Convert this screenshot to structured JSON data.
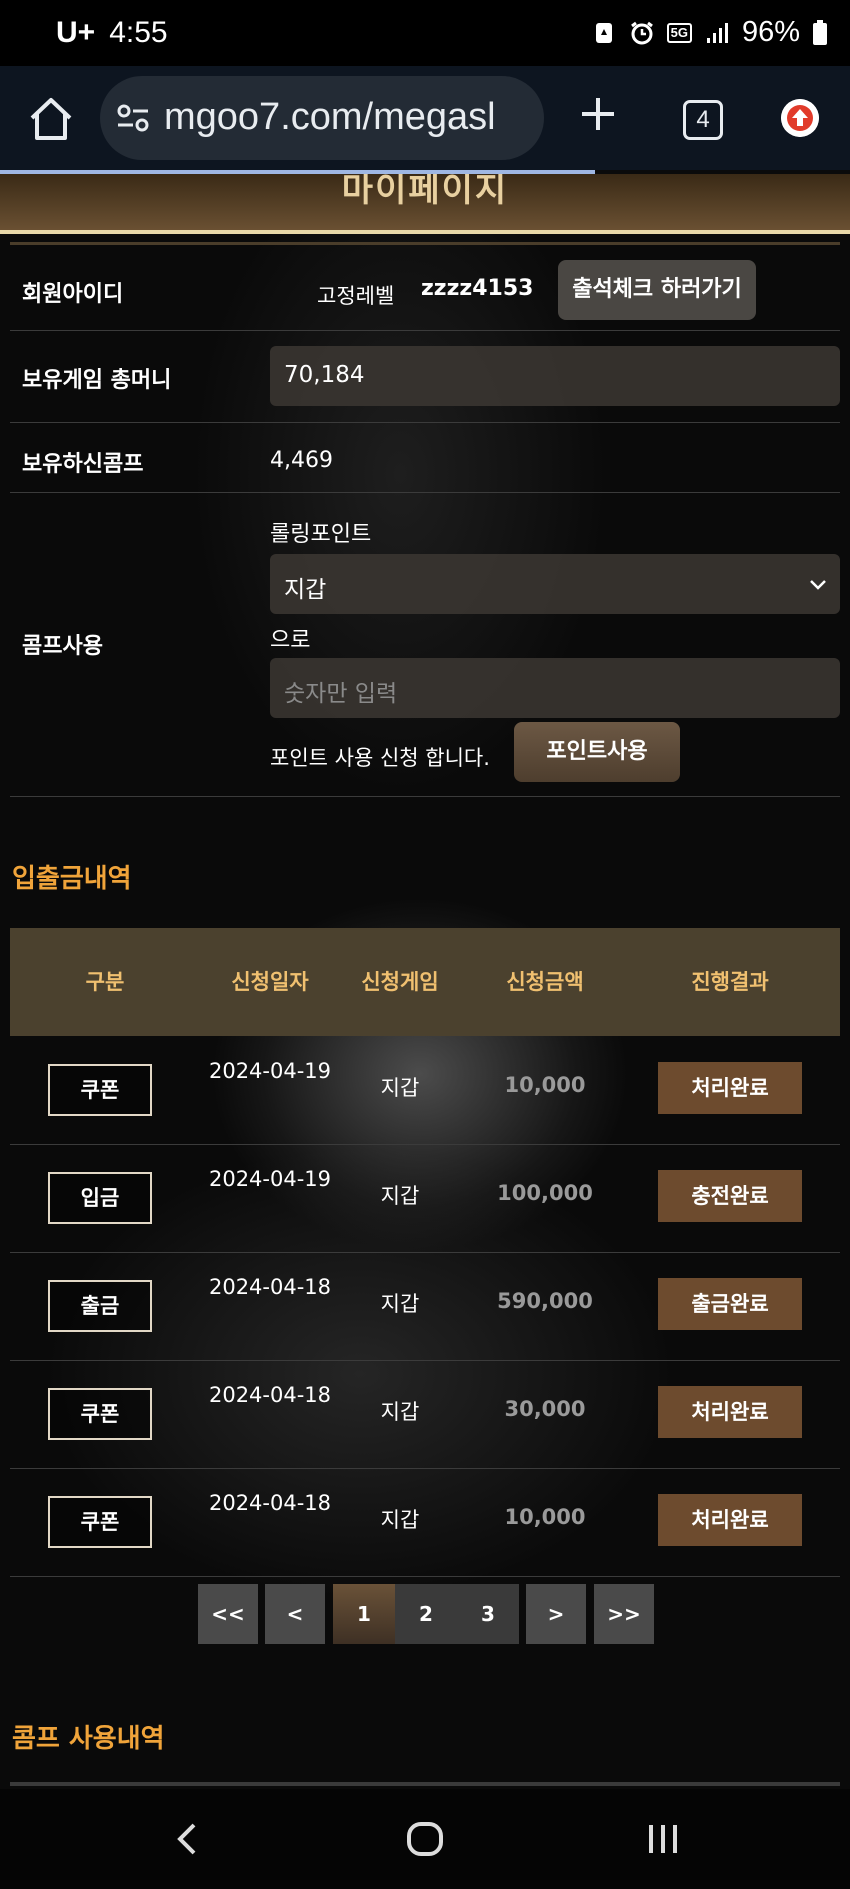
{
  "status_bar": {
    "carrier": "U+",
    "time": "4:55",
    "network": "5G",
    "battery": "96%"
  },
  "browser": {
    "url": "mgoo7.com/megasl",
    "tab_count": "4"
  },
  "page": {
    "banner_title": "마이페이지",
    "member": {
      "id_label": "회원아이디",
      "level_label": "고정레벨",
      "user_id": "zzzz4153",
      "attendance_button": "출석체크 하러가기"
    },
    "money": {
      "label": "보유게임 총머니",
      "value": "70,184"
    },
    "comp": {
      "label": "보유하신콤프",
      "value": "4,469"
    },
    "comp_use": {
      "label": "콤프사용",
      "rolling_label": "롤링포인트",
      "select_value": "지갑",
      "to_label": "으로",
      "amount_placeholder": "숫자만 입력",
      "apply_text": "포인트 사용 신청 합니다.",
      "apply_button": "포인트사용"
    },
    "history": {
      "title": "입출금내역",
      "headers": [
        "구분",
        "신청일자",
        "신청게임",
        "신청금액",
        "진행결과"
      ],
      "rows": [
        {
          "type": "쿠폰",
          "date": "2024-04-19",
          "game": "지갑",
          "amount": "10,000",
          "status": "처리완료"
        },
        {
          "type": "입금",
          "date": "2024-04-19",
          "game": "지갑",
          "amount": "100,000",
          "status": "충전완료"
        },
        {
          "type": "출금",
          "date": "2024-04-18",
          "game": "지갑",
          "amount": "590,000",
          "status": "출금완료"
        },
        {
          "type": "쿠폰",
          "date": "2024-04-18",
          "game": "지갑",
          "amount": "30,000",
          "status": "처리완료"
        },
        {
          "type": "쿠폰",
          "date": "2024-04-18",
          "game": "지갑",
          "amount": "10,000",
          "status": "처리완료"
        }
      ]
    },
    "pagination": {
      "first": "<<",
      "prev": "<",
      "pages": [
        "1",
        "2",
        "3"
      ],
      "active_page": "1",
      "next": ">",
      "last": ">>"
    },
    "comp_history_title": "콤프 사용내역"
  },
  "colors": {
    "accent_orange": "#f0a43a",
    "header_gold": "#f0c070",
    "status_brown": "#6d4b2e"
  }
}
